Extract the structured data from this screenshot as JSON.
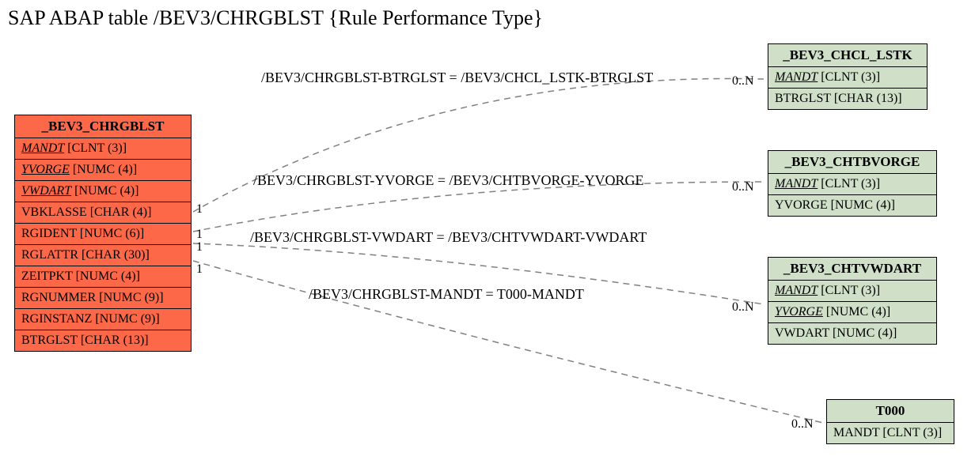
{
  "title": "SAP ABAP table /BEV3/CHRGBLST {Rule Performance Type}",
  "main_table": {
    "name": "_BEV3_CHRGBLST",
    "fields": [
      {
        "name": "MANDT",
        "type": "[CLNT (3)]",
        "key": true
      },
      {
        "name": "YVORGE",
        "type": "[NUMC (4)]",
        "key": true
      },
      {
        "name": "VWDART",
        "type": "[NUMC (4)]",
        "key": true
      },
      {
        "name": "VBKLASSE",
        "type": "[CHAR (4)]",
        "key": false
      },
      {
        "name": "RGIDENT",
        "type": "[NUMC (6)]",
        "key": false
      },
      {
        "name": "RGLATTR",
        "type": "[CHAR (30)]",
        "key": false
      },
      {
        "name": "ZEITPKT",
        "type": "[NUMC (4)]",
        "key": false
      },
      {
        "name": "RGNUMMER",
        "type": "[NUMC (9)]",
        "key": false
      },
      {
        "name": "RGINSTANZ",
        "type": "[NUMC (9)]",
        "key": false
      },
      {
        "name": "BTRGLST",
        "type": "[CHAR (13)]",
        "key": false
      }
    ]
  },
  "ref_tables": [
    {
      "name": "_BEV3_CHCL_LSTK",
      "fields": [
        {
          "name": "MANDT",
          "type": "[CLNT (3)]",
          "key": true
        },
        {
          "name": "BTRGLST",
          "type": "[CHAR (13)]",
          "key": false
        }
      ]
    },
    {
      "name": "_BEV3_CHTBVORGE",
      "fields": [
        {
          "name": "MANDT",
          "type": "[CLNT (3)]",
          "key": true
        },
        {
          "name": "YVORGE",
          "type": "[NUMC (4)]",
          "key": false
        }
      ]
    },
    {
      "name": "_BEV3_CHTVWDART",
      "fields": [
        {
          "name": "MANDT",
          "type": "[CLNT (3)]",
          "key": true
        },
        {
          "name": "YVORGE",
          "type": "[NUMC (4)]",
          "key": true
        },
        {
          "name": "VWDART",
          "type": "[NUMC (4)]",
          "key": false
        }
      ]
    },
    {
      "name": "T000",
      "fields": [
        {
          "name": "MANDT",
          "type": "[CLNT (3)]",
          "key": false
        }
      ]
    }
  ],
  "relations": [
    {
      "label": "/BEV3/CHRGBLST-BTRGLST = /BEV3/CHCL_LSTK-BTRGLST",
      "left_card": "1",
      "right_card": "0..N"
    },
    {
      "label": "/BEV3/CHRGBLST-YVORGE = /BEV3/CHTBVORGE-YVORGE",
      "left_card": "1",
      "right_card": "0..N"
    },
    {
      "label": "/BEV3/CHRGBLST-VWDART = /BEV3/CHTVWDART-VWDART",
      "left_card": "1",
      "right_card": "0..N"
    },
    {
      "label": "/BEV3/CHRGBLST-MANDT = T000-MANDT",
      "left_card": "1",
      "right_card": "0..N"
    }
  ]
}
